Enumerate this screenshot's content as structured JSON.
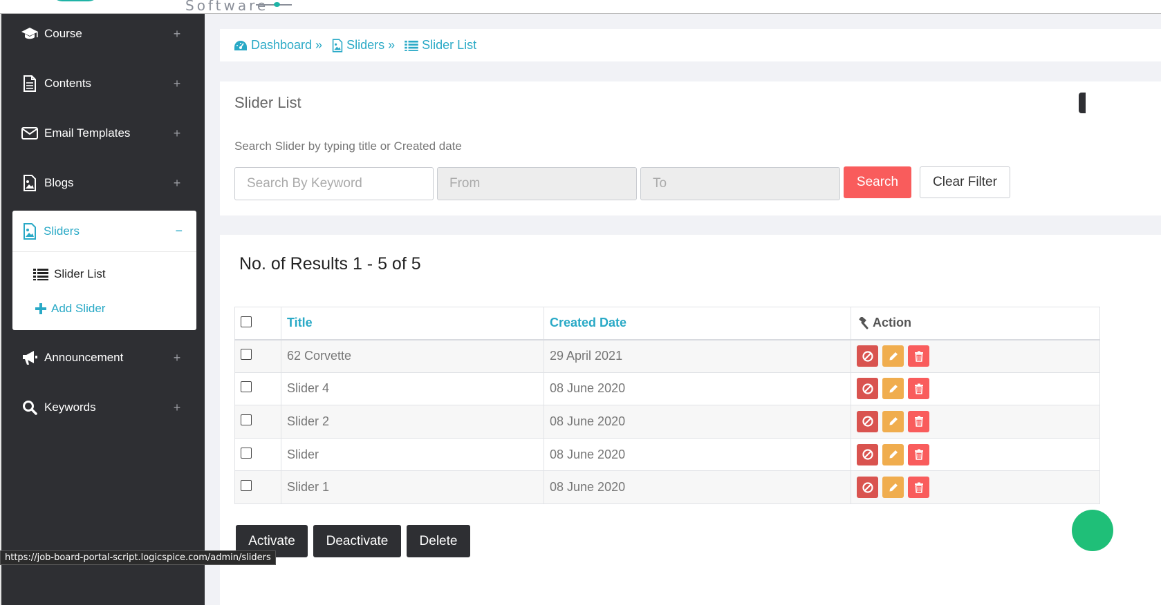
{
  "header": {
    "logo_text": "Software"
  },
  "sidebar": {
    "items": [
      {
        "label": "Course",
        "icon": "graduation-cap-icon",
        "toggle": "+"
      },
      {
        "label": "Contents",
        "icon": "file-icon",
        "toggle": "+"
      },
      {
        "label": "Email Templates",
        "icon": "envelope-icon",
        "toggle": "+"
      },
      {
        "label": "Blogs",
        "icon": "image-file-icon",
        "toggle": "+"
      },
      {
        "label": "Sliders",
        "icon": "image-file-icon",
        "toggle": "−"
      },
      {
        "label": "Announcement",
        "icon": "bullhorn-icon",
        "toggle": "+"
      },
      {
        "label": "Keywords",
        "icon": "search-icon",
        "toggle": "+"
      }
    ],
    "submenu": [
      {
        "label": "Slider List",
        "icon": "list-icon"
      },
      {
        "label": "Add Slider",
        "icon": "plus-icon"
      }
    ]
  },
  "breadcrumb": [
    {
      "label": "Dashboard »",
      "icon": "dashboard-icon"
    },
    {
      "label": "Sliders »",
      "icon": "image-file-icon"
    },
    {
      "label": "Slider List",
      "icon": "list-icon"
    }
  ],
  "search_card": {
    "title": "Slider List",
    "hint": "Search Slider by typing title or Created date",
    "keyword_placeholder": "Search By Keyword",
    "from_placeholder": "From",
    "to_placeholder": "To",
    "search_label": "Search",
    "clear_label": "Clear Filter"
  },
  "results": {
    "title": "No. of Results 1 - 5 of 5",
    "columns": [
      "Title",
      "Created Date",
      "Action"
    ],
    "rows": [
      {
        "title": "62 Corvette",
        "date": "29 April 2021"
      },
      {
        "title": "Slider 4",
        "date": "08 June 2020"
      },
      {
        "title": "Slider 2",
        "date": "08 June 2020"
      },
      {
        "title": "Slider",
        "date": "08 June 2020"
      },
      {
        "title": "Slider 1",
        "date": "08 June 2020"
      }
    ],
    "bulk_actions": [
      "Activate",
      "Deactivate",
      "Delete"
    ]
  },
  "colors": {
    "accent": "#29a9c6",
    "sidebar_bg": "#2e2f33",
    "search_button": "#f95c5c",
    "deactivate": "#d9534f",
    "edit": "#f0ad4e",
    "delete": "#f95c5c"
  },
  "status_url": "https://job-board-portal-script.logicspice.com/admin/sliders"
}
